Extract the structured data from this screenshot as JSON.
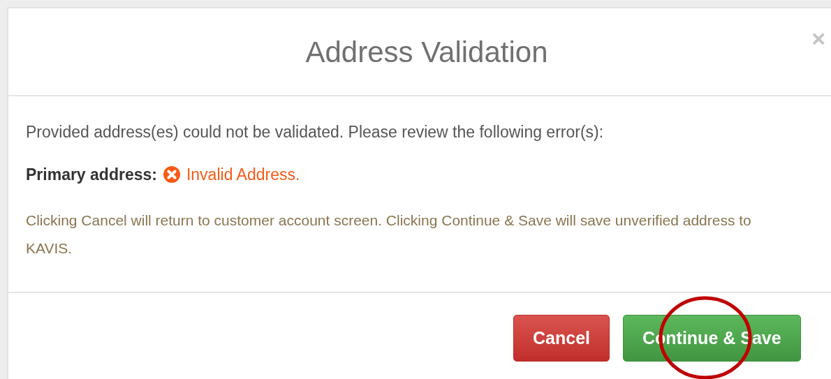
{
  "dialog": {
    "title": "Address Validation",
    "close": "×",
    "message": "Provided address(es) could not be validated. Please review the following error(s):",
    "errors": [
      {
        "label": "Primary address:",
        "text": "Invalid Address."
      }
    ],
    "note": "Clicking Cancel will return to customer account screen. Clicking Continue & Save will save unverified address to KAVIS.",
    "buttons": [
      {
        "label": "Cancel",
        "kind": "danger",
        "highlighted": false
      },
      {
        "label": "Continue & Save",
        "kind": "success",
        "highlighted": true
      }
    ]
  }
}
